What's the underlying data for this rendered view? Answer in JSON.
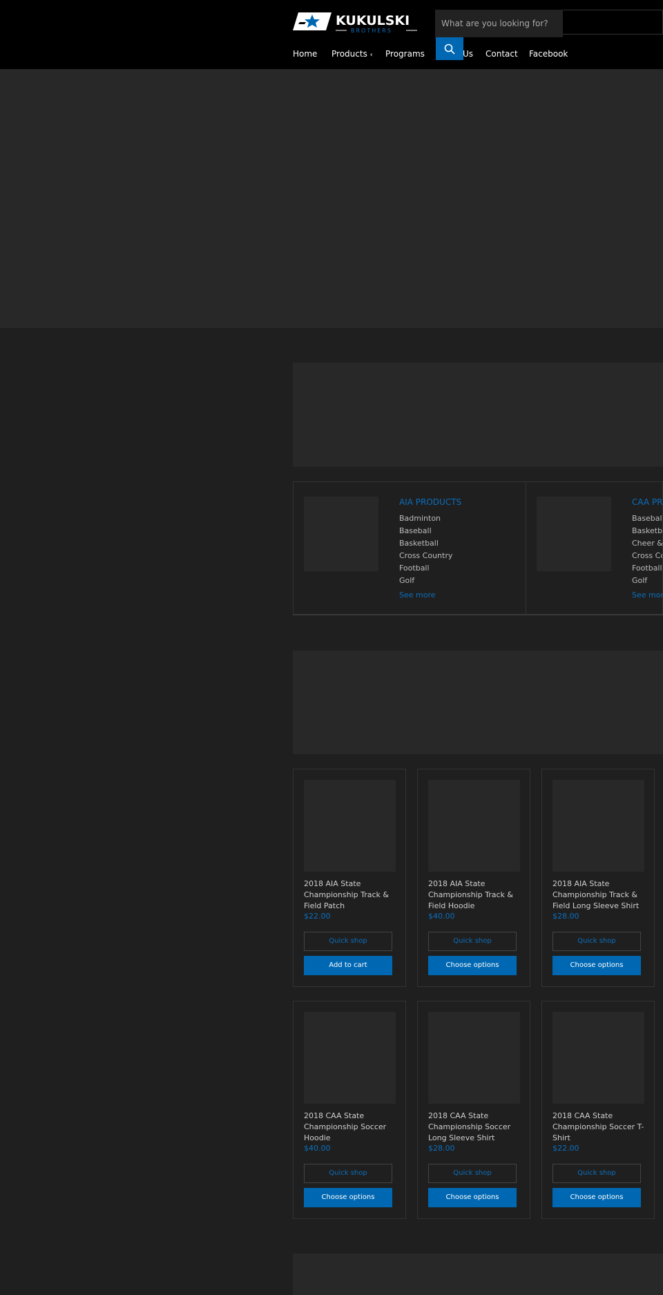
{
  "brand": {
    "name": "KUKULSKI",
    "tagline": "BROTHERS",
    "accent": "#0068b3",
    "link_color": "#0b6fbd"
  },
  "search": {
    "placeholder": "What are you looking for?",
    "icon": "search-icon"
  },
  "nav": {
    "items": [
      {
        "label": "Home"
      },
      {
        "label": "Products",
        "icon": "chevron-icon"
      },
      {
        "label": "Programs"
      },
      {
        "label": "Us"
      },
      {
        "label": "Contact"
      },
      {
        "label": "Facebook"
      }
    ]
  },
  "collections": [
    {
      "title": "AIA PRODUCTS",
      "items": [
        "Badminton",
        "Baseball",
        "Basketball",
        "Cross Country",
        "Football",
        "Golf"
      ],
      "more": "See more"
    },
    {
      "title": "CAA PRO",
      "items": [
        "Baseball",
        "Basketba",
        "Cheer & D",
        "Cross Cou",
        "Football",
        "Golf"
      ],
      "more": "See more"
    }
  ],
  "products": [
    {
      "title": "2018 AIA State Championship Track & Field Patch",
      "price": "$22.00",
      "quick": "Quick shop",
      "action": "Add to cart"
    },
    {
      "title": "2018 AIA State Championship Track & Field Hoodie",
      "price": "$40.00",
      "quick": "Quick shop",
      "action": "Choose options"
    },
    {
      "title": "2018 AIA State Championship Track & Field Long Sleeve Shirt",
      "price": "$28.00",
      "quick": "Quick shop",
      "action": "Choose options"
    },
    {
      "title": "2018 CAA State Championship Soccer Hoodie",
      "price": "$40.00",
      "quick": "Quick shop",
      "action": "Choose options"
    },
    {
      "title": "2018 CAA State Championship Soccer Long Sleeve Shirt",
      "price": "$28.00",
      "quick": "Quick shop",
      "action": "Choose options"
    },
    {
      "title": "2018 CAA State Championship Soccer T-Shirt",
      "price": "$22.00",
      "quick": "Quick shop",
      "action": "Choose options"
    }
  ]
}
